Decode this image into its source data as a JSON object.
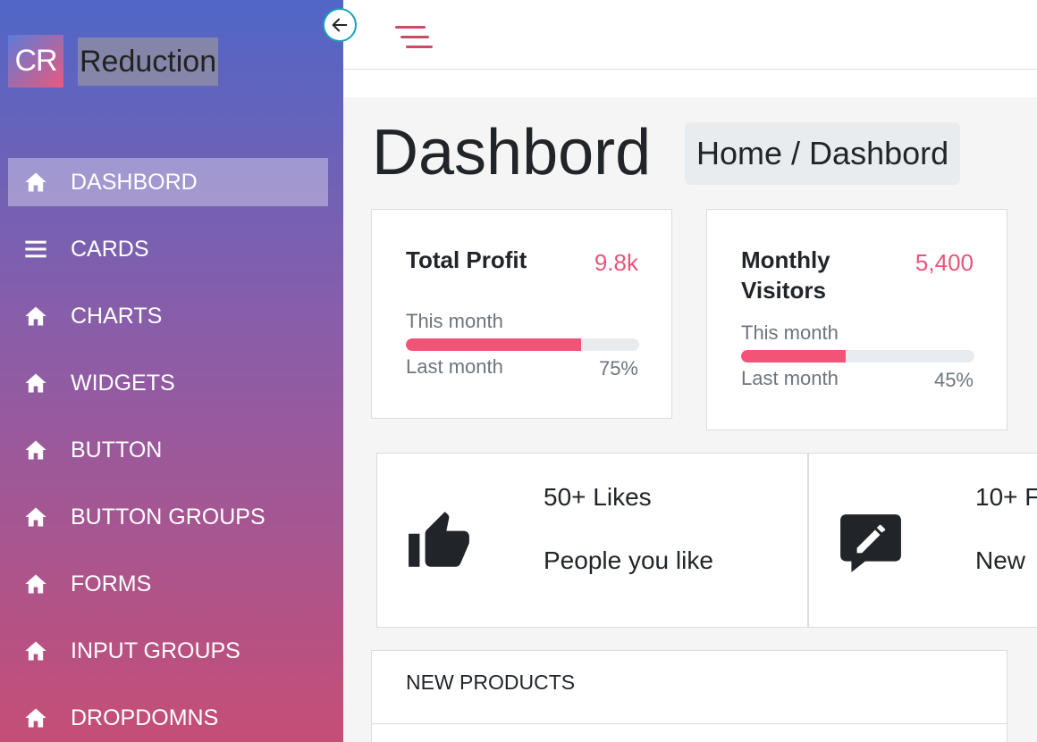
{
  "brand": {
    "logo_text": "CR",
    "name": "Reduction"
  },
  "sidebar": {
    "items": [
      {
        "label": "DASHBORD",
        "icon": "home-icon",
        "active": true
      },
      {
        "label": "CARDS",
        "icon": "list-icon",
        "active": false
      },
      {
        "label": "CHARTS",
        "icon": "home-icon",
        "active": false
      },
      {
        "label": "WIDGETS",
        "icon": "home-icon",
        "active": false
      },
      {
        "label": "BUTTON",
        "icon": "home-icon",
        "active": false
      },
      {
        "label": "BUTTON GROUPS",
        "icon": "home-icon",
        "active": false
      },
      {
        "label": "FORMS",
        "icon": "home-icon",
        "active": false
      },
      {
        "label": "INPUT GROUPS",
        "icon": "home-icon",
        "active": false
      },
      {
        "label": "DROPDOMNS",
        "icon": "home-icon",
        "active": false
      }
    ]
  },
  "header": {
    "collapse_icon": "arrow-left-icon",
    "menu_icon": "hamburger-icon"
  },
  "page": {
    "title": "Dashbord",
    "breadcrumb": {
      "home": "Home",
      "separator": "/",
      "current": "Dashbord"
    }
  },
  "stats": [
    {
      "title": "Total Profit",
      "value": "9.8k",
      "this_month_label": "This month",
      "last_month_label": "Last month",
      "percent_label": "75%",
      "percent": 75
    },
    {
      "title": "Monthly Visitors",
      "value": "5,400",
      "this_month_label": "This month",
      "last_month_label": "Last month",
      "percent_label": "45%",
      "percent": 45
    }
  ],
  "features": [
    {
      "icon": "thumbs-up-icon",
      "title": "50+ Likes",
      "subtitle": "People you like"
    },
    {
      "icon": "comment-edit-icon",
      "title": "10+ F",
      "subtitle": "New"
    }
  ],
  "products": {
    "title": "NEW PRODUCTS"
  },
  "colors": {
    "accent": "#e8557a",
    "progress": "#f25478",
    "sidebar_top": "#5166c6",
    "sidebar_bottom": "#c54e76"
  }
}
